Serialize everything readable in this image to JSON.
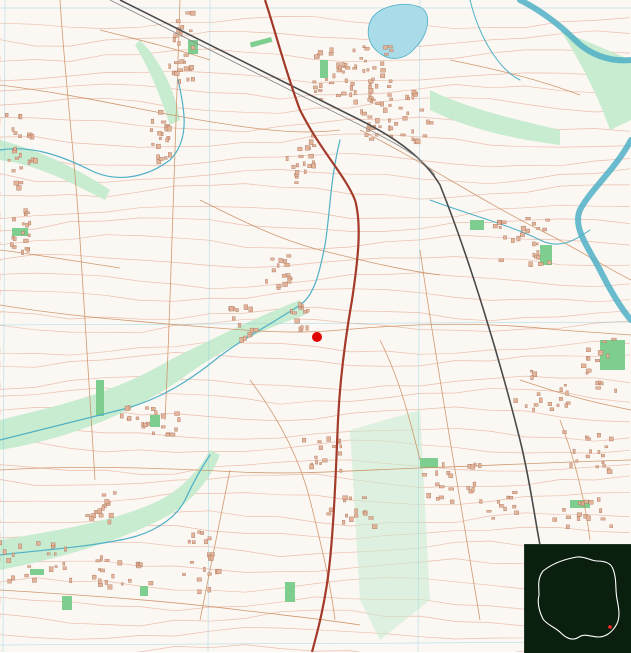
{
  "map": {
    "type": "topographic-map",
    "colors": {
      "background": "#fbf7f3",
      "contours": "#e9b9a6",
      "roads": "#c98a5a",
      "main_road": "#a33a2a",
      "railway": "#4a4a4a",
      "river": "#4fb0c6",
      "lake": "#a9dbe8",
      "forest": "#7ecf8f",
      "meadow": "#c7ecd0",
      "settlement": "#e2b49a",
      "grid": "#8ccfe0"
    },
    "location_marker": {
      "shape": "circle",
      "color": "#e00000"
    },
    "inset": {
      "name": "Poland overview",
      "background": "#0b1f0f",
      "outline_color": "#ffffff",
      "marker_color": "#ff2a2a"
    }
  }
}
